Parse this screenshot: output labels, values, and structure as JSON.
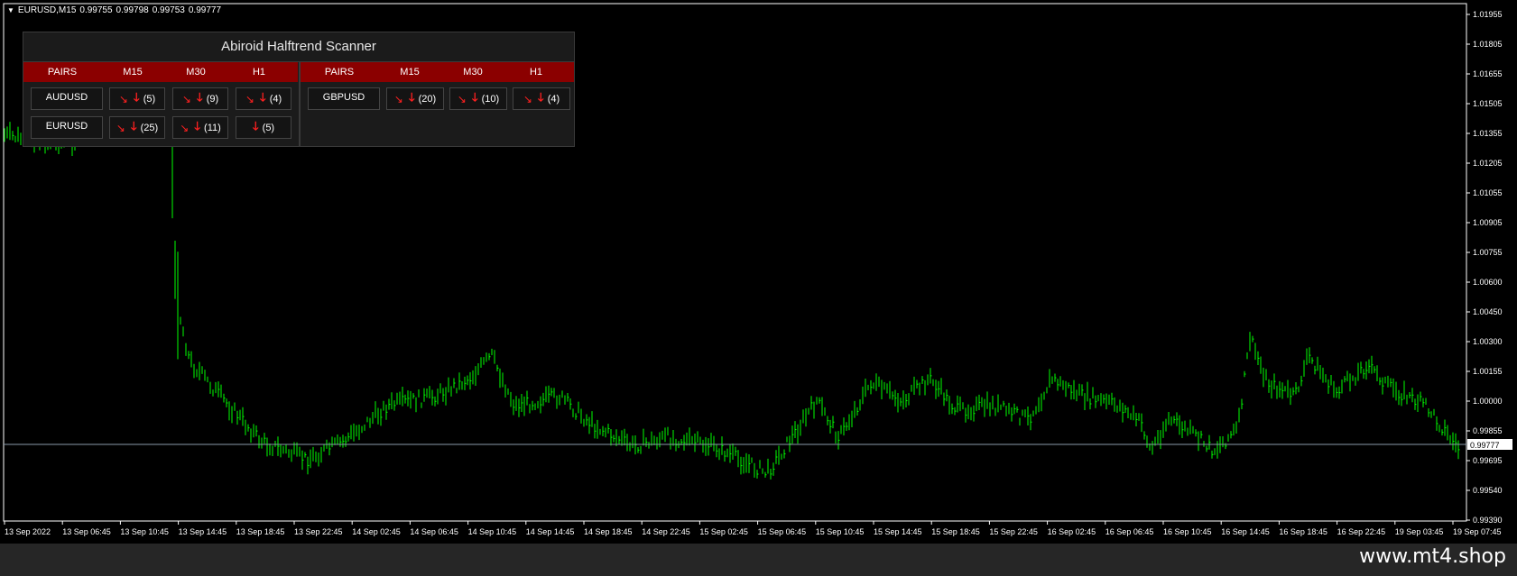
{
  "chart": {
    "info": {
      "symbol": "EURUSD,M15",
      "open": "0.99755",
      "high": "0.99798",
      "low": "0.99753",
      "close": "0.99777"
    },
    "current_price": "0.99777",
    "price_axis": [
      "1.01955",
      "1.01805",
      "1.01655",
      "1.01505",
      "1.01355",
      "1.01205",
      "1.01055",
      "1.00905",
      "1.00755",
      "1.00600",
      "1.00450",
      "1.00300",
      "1.00155",
      "1.00000",
      "0.99855",
      "0.99695",
      "0.99540",
      "0.99390"
    ],
    "time_axis": [
      "13 Sep 2022",
      "13 Sep 06:45",
      "13 Sep 10:45",
      "13 Sep 14:45",
      "13 Sep 18:45",
      "13 Sep 22:45",
      "14 Sep 02:45",
      "14 Sep 06:45",
      "14 Sep 10:45",
      "14 Sep 14:45",
      "14 Sep 18:45",
      "14 Sep 22:45",
      "15 Sep 02:45",
      "15 Sep 06:45",
      "15 Sep 10:45",
      "15 Sep 14:45",
      "15 Sep 18:45",
      "15 Sep 22:45",
      "16 Sep 02:45",
      "16 Sep 06:45",
      "16 Sep 10:45",
      "16 Sep 14:45",
      "16 Sep 18:45",
      "16 Sep 22:45",
      "19 Sep 03:45",
      "19 Sep 07:45"
    ],
    "colors": {
      "bars": "#00ff00",
      "background": "#000000",
      "bid_line": "#8a9aaa"
    }
  },
  "scanner": {
    "title": "Abiroid Halftrend Scanner",
    "left_headers": [
      "PAIRS",
      "M15",
      "M30",
      "H1"
    ],
    "right_headers": [
      "PAIRS",
      "M15",
      "M30",
      "H1"
    ],
    "left_rows": [
      {
        "pair": "AUDUSD",
        "m15": "(5)",
        "m30": "(9)",
        "h1": "(4)"
      },
      {
        "pair": "EURUSD",
        "m15": "(25)",
        "m30": "(11)",
        "h1": "(5)"
      }
    ],
    "right_rows": [
      {
        "pair": "GBPUSD",
        "m15": "(20)",
        "m30": "(10)",
        "h1": "(4)"
      }
    ],
    "colors": {
      "header_bg": "#8b0000",
      "arrow": "#ff2020"
    }
  },
  "watermark": "www.mt4.shop"
}
